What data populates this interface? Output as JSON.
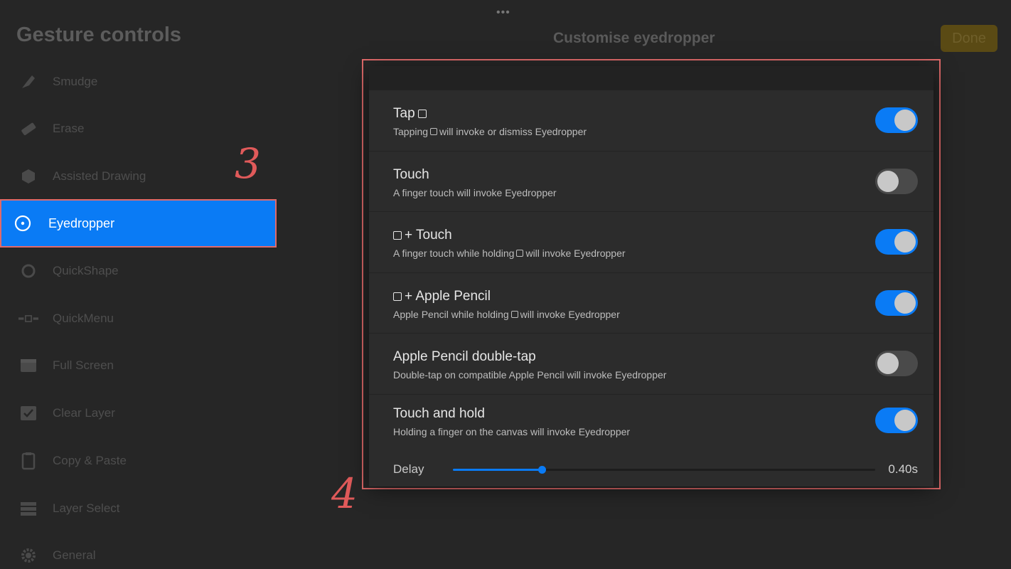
{
  "header": {
    "grabber": "•••",
    "left_title": "Gesture controls",
    "center_title": "Customise eyedropper",
    "done_label": "Done"
  },
  "sidebar": {
    "items": [
      {
        "label": "Smudge",
        "icon": "smudge-icon"
      },
      {
        "label": "Erase",
        "icon": "eraser-icon"
      },
      {
        "label": "Assisted Drawing",
        "icon": "cube-icon"
      },
      {
        "label": "Eyedropper",
        "icon": "eyedropper-icon",
        "active": true
      },
      {
        "label": "QuickShape",
        "icon": "quickshape-icon"
      },
      {
        "label": "QuickMenu",
        "icon": "quickmenu-icon"
      },
      {
        "label": "Full Screen",
        "icon": "fullscreen-icon"
      },
      {
        "label": "Clear Layer",
        "icon": "checkbox-icon"
      },
      {
        "label": "Copy & Paste",
        "icon": "clipboard-icon"
      },
      {
        "label": "Layer Select",
        "icon": "layers-icon"
      },
      {
        "label": "General",
        "icon": "gear-icon"
      }
    ]
  },
  "annotations": {
    "step3": "3",
    "step4": "4"
  },
  "settings": {
    "rows": [
      {
        "title": "Tap",
        "desc_pre": "Tapping",
        "desc_post": "will invoke or dismiss Eyedropper",
        "on": true
      },
      {
        "title": "Touch",
        "desc": "A finger touch will invoke Eyedropper",
        "on": false
      },
      {
        "title": "+ Touch",
        "desc_pre": "A finger touch while holding",
        "desc_post": "will invoke Eyedropper",
        "on": true
      },
      {
        "title": "+ Apple Pencil",
        "desc_pre": "Apple Pencil while holding",
        "desc_post": "will invoke Eyedropper",
        "on": true
      },
      {
        "title": "Apple Pencil double-tap",
        "desc": "Double-tap on compatible Apple Pencil will invoke Eyedropper",
        "on": false
      },
      {
        "title": "Touch and hold",
        "desc": "Holding a finger on the canvas will invoke Eyedropper",
        "on": true
      }
    ],
    "delay": {
      "label": "Delay",
      "value": "0.40s",
      "fraction": 0.21
    }
  },
  "colors": {
    "accent": "#0a7bf5",
    "annotation": "#e06a6a",
    "done_bg": "#5a4a14"
  }
}
